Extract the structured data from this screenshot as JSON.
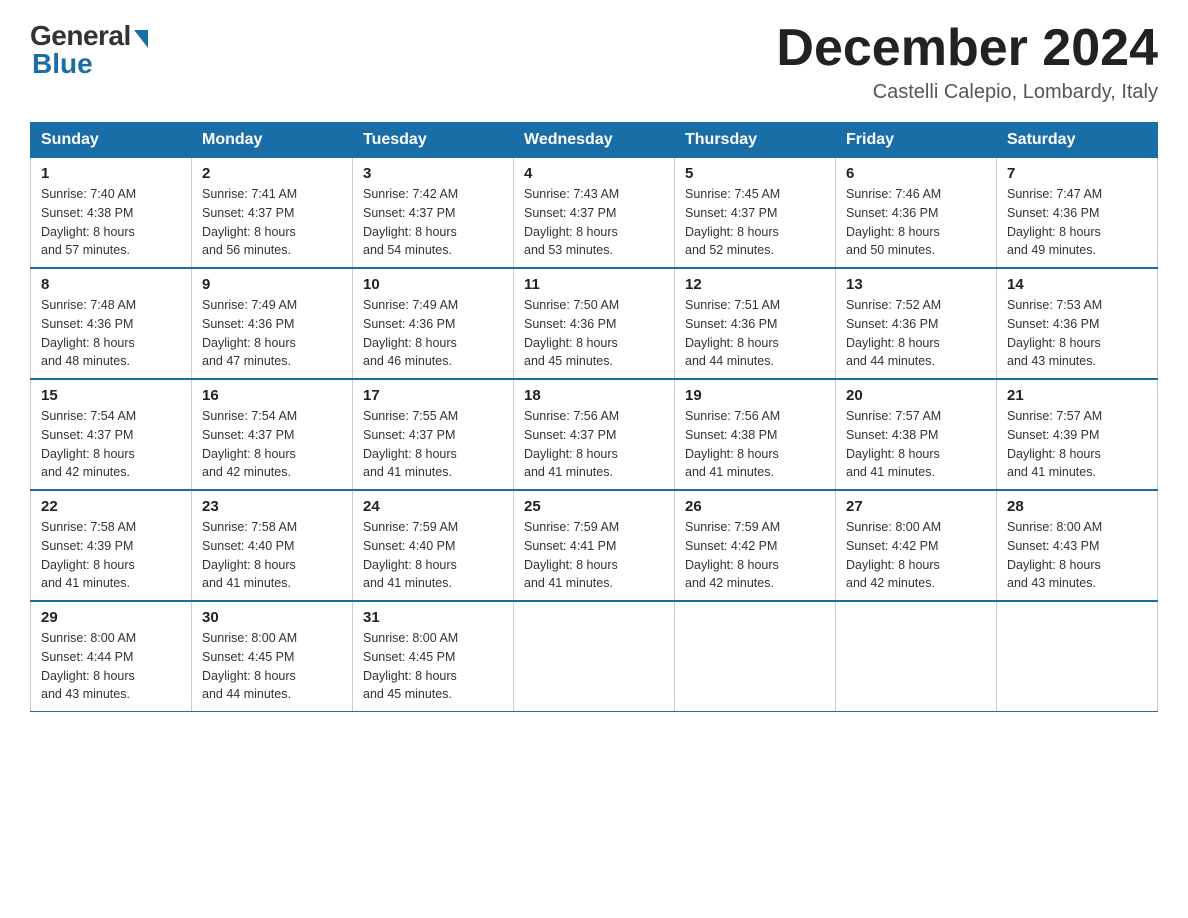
{
  "logo": {
    "general": "General",
    "blue": "Blue"
  },
  "title": "December 2024",
  "subtitle": "Castelli Calepio, Lombardy, Italy",
  "headers": [
    "Sunday",
    "Monday",
    "Tuesday",
    "Wednesday",
    "Thursday",
    "Friday",
    "Saturday"
  ],
  "weeks": [
    [
      {
        "day": "1",
        "sunrise": "7:40 AM",
        "sunset": "4:38 PM",
        "daylight": "8 hours and 57 minutes."
      },
      {
        "day": "2",
        "sunrise": "7:41 AM",
        "sunset": "4:37 PM",
        "daylight": "8 hours and 56 minutes."
      },
      {
        "day": "3",
        "sunrise": "7:42 AM",
        "sunset": "4:37 PM",
        "daylight": "8 hours and 54 minutes."
      },
      {
        "day": "4",
        "sunrise": "7:43 AM",
        "sunset": "4:37 PM",
        "daylight": "8 hours and 53 minutes."
      },
      {
        "day": "5",
        "sunrise": "7:45 AM",
        "sunset": "4:37 PM",
        "daylight": "8 hours and 52 minutes."
      },
      {
        "day": "6",
        "sunrise": "7:46 AM",
        "sunset": "4:36 PM",
        "daylight": "8 hours and 50 minutes."
      },
      {
        "day": "7",
        "sunrise": "7:47 AM",
        "sunset": "4:36 PM",
        "daylight": "8 hours and 49 minutes."
      }
    ],
    [
      {
        "day": "8",
        "sunrise": "7:48 AM",
        "sunset": "4:36 PM",
        "daylight": "8 hours and 48 minutes."
      },
      {
        "day": "9",
        "sunrise": "7:49 AM",
        "sunset": "4:36 PM",
        "daylight": "8 hours and 47 minutes."
      },
      {
        "day": "10",
        "sunrise": "7:49 AM",
        "sunset": "4:36 PM",
        "daylight": "8 hours and 46 minutes."
      },
      {
        "day": "11",
        "sunrise": "7:50 AM",
        "sunset": "4:36 PM",
        "daylight": "8 hours and 45 minutes."
      },
      {
        "day": "12",
        "sunrise": "7:51 AM",
        "sunset": "4:36 PM",
        "daylight": "8 hours and 44 minutes."
      },
      {
        "day": "13",
        "sunrise": "7:52 AM",
        "sunset": "4:36 PM",
        "daylight": "8 hours and 44 minutes."
      },
      {
        "day": "14",
        "sunrise": "7:53 AM",
        "sunset": "4:36 PM",
        "daylight": "8 hours and 43 minutes."
      }
    ],
    [
      {
        "day": "15",
        "sunrise": "7:54 AM",
        "sunset": "4:37 PM",
        "daylight": "8 hours and 42 minutes."
      },
      {
        "day": "16",
        "sunrise": "7:54 AM",
        "sunset": "4:37 PM",
        "daylight": "8 hours and 42 minutes."
      },
      {
        "day": "17",
        "sunrise": "7:55 AM",
        "sunset": "4:37 PM",
        "daylight": "8 hours and 41 minutes."
      },
      {
        "day": "18",
        "sunrise": "7:56 AM",
        "sunset": "4:37 PM",
        "daylight": "8 hours and 41 minutes."
      },
      {
        "day": "19",
        "sunrise": "7:56 AM",
        "sunset": "4:38 PM",
        "daylight": "8 hours and 41 minutes."
      },
      {
        "day": "20",
        "sunrise": "7:57 AM",
        "sunset": "4:38 PM",
        "daylight": "8 hours and 41 minutes."
      },
      {
        "day": "21",
        "sunrise": "7:57 AM",
        "sunset": "4:39 PM",
        "daylight": "8 hours and 41 minutes."
      }
    ],
    [
      {
        "day": "22",
        "sunrise": "7:58 AM",
        "sunset": "4:39 PM",
        "daylight": "8 hours and 41 minutes."
      },
      {
        "day": "23",
        "sunrise": "7:58 AM",
        "sunset": "4:40 PM",
        "daylight": "8 hours and 41 minutes."
      },
      {
        "day": "24",
        "sunrise": "7:59 AM",
        "sunset": "4:40 PM",
        "daylight": "8 hours and 41 minutes."
      },
      {
        "day": "25",
        "sunrise": "7:59 AM",
        "sunset": "4:41 PM",
        "daylight": "8 hours and 41 minutes."
      },
      {
        "day": "26",
        "sunrise": "7:59 AM",
        "sunset": "4:42 PM",
        "daylight": "8 hours and 42 minutes."
      },
      {
        "day": "27",
        "sunrise": "8:00 AM",
        "sunset": "4:42 PM",
        "daylight": "8 hours and 42 minutes."
      },
      {
        "day": "28",
        "sunrise": "8:00 AM",
        "sunset": "4:43 PM",
        "daylight": "8 hours and 43 minutes."
      }
    ],
    [
      {
        "day": "29",
        "sunrise": "8:00 AM",
        "sunset": "4:44 PM",
        "daylight": "8 hours and 43 minutes."
      },
      {
        "day": "30",
        "sunrise": "8:00 AM",
        "sunset": "4:45 PM",
        "daylight": "8 hours and 44 minutes."
      },
      {
        "day": "31",
        "sunrise": "8:00 AM",
        "sunset": "4:45 PM",
        "daylight": "8 hours and 45 minutes."
      },
      null,
      null,
      null,
      null
    ]
  ],
  "labels": {
    "sunrise": "Sunrise:",
    "sunset": "Sunset:",
    "daylight": "Daylight:"
  }
}
